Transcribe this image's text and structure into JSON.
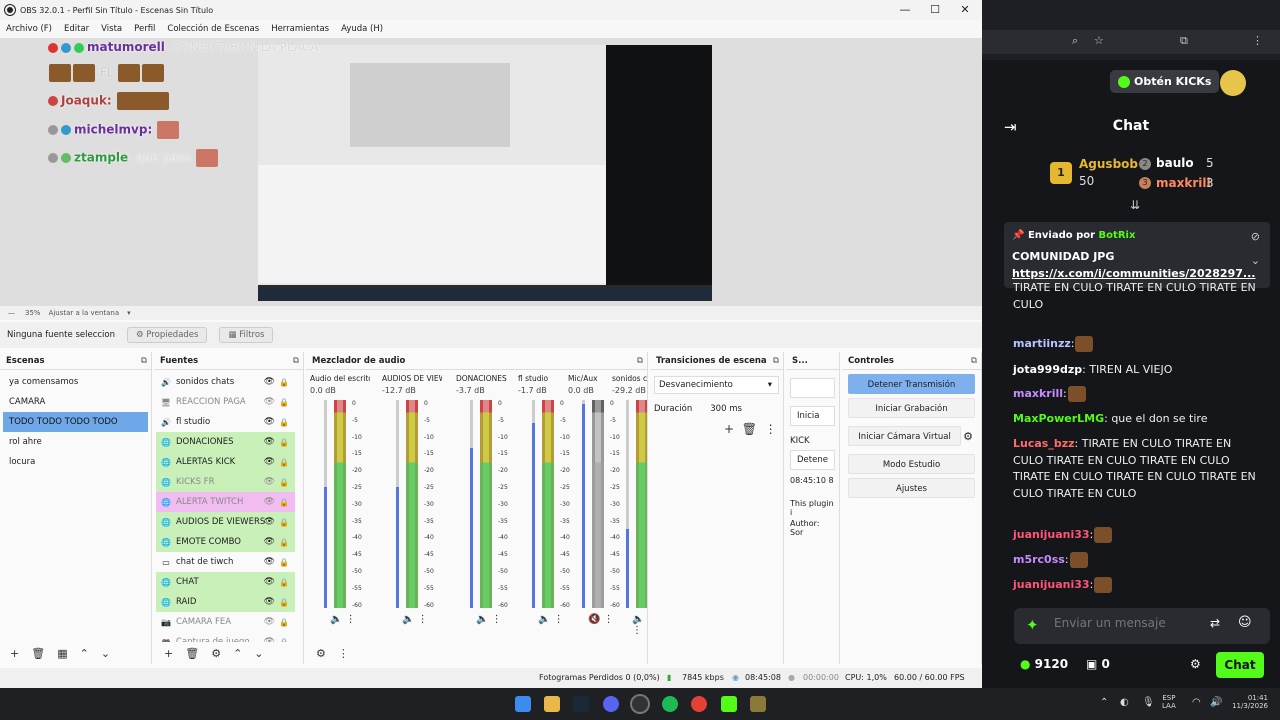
{
  "window": {
    "title": "OBS 32.0.1 - Perfil: Sin Título - Escenas: Sin Título",
    "title_visible": "OBS 32.0.1 - Perfil Sin Título - Escenas Sin Título",
    "minimize": "—",
    "maximize": "☐",
    "close": "✕"
  },
  "menu": [
    "Archivo (F)",
    "Editar",
    "Vista",
    "Perfil",
    "Colección de Escenas",
    "Herramientas",
    "Ayuda (H)"
  ],
  "overlay": [
    {
      "user": "matumorell",
      "text": ": CONECTARON LA PLACA",
      "color": "#6a2f9a"
    },
    {
      "user": "",
      "text": "FL",
      "color": "#c8c8c8"
    },
    {
      "user": "Joaquk",
      "text": ":",
      "color": "#b04040"
    },
    {
      "user": "michelmvp",
      "text": ":",
      "color": "#6a2f9a"
    },
    {
      "user": "ztample",
      "text": ": que paso",
      "color": "#2f9a40"
    }
  ],
  "zoom": {
    "value": "35%",
    "fit": "Ajustar a la ventana"
  },
  "source_toolbar": {
    "no_selection": "Ninguna fuente seleccionada",
    "properties": "Propiedades",
    "filters": "Filtros"
  },
  "scenes": {
    "title": "Escenas",
    "items": [
      "ya comensamos",
      "CAMARA",
      "TODO TODO TODO TODO",
      "rol ahre",
      "locura"
    ],
    "selected": 2
  },
  "sources": {
    "title": "Fuentes",
    "items": [
      {
        "name": "sonidos chats",
        "style": "",
        "icon": "🔊"
      },
      {
        "name": "REACCION PAGA",
        "style": "dim",
        "icon": "🖥"
      },
      {
        "name": "fl studio",
        "style": "",
        "icon": "🔊"
      },
      {
        "name": "DONACIONES",
        "style": "g",
        "icon": "🌐"
      },
      {
        "name": "ALERTAS KICK",
        "style": "g",
        "icon": "🌐"
      },
      {
        "name": "KICKS FR",
        "style": "g dim",
        "icon": "🌐"
      },
      {
        "name": "ALERTA TWITCH",
        "style": "p dim",
        "icon": "🌐"
      },
      {
        "name": "AUDIOS DE VIEWERS",
        "style": "g",
        "icon": "🌐"
      },
      {
        "name": "EMOTE COMBO",
        "style": "g",
        "icon": "🌐"
      },
      {
        "name": "chat de tiwch",
        "style": "",
        "icon": "▭"
      },
      {
        "name": "CHAT",
        "style": "g",
        "icon": "🌐"
      },
      {
        "name": "RAID",
        "style": "g",
        "icon": "🌐"
      },
      {
        "name": "CAMARA FEA",
        "style": "dim",
        "icon": "📷"
      },
      {
        "name": "Captura de juego",
        "style": "dim",
        "icon": "🎮"
      }
    ]
  },
  "mixer": {
    "title": "Mezclador de audio",
    "channels": [
      {
        "name": "Audio del escritorio",
        "db": "0.0 dB",
        "level": 0.58,
        "muted": false
      },
      {
        "name": "AUDIOS DE VIEWERS",
        "db": "-12.7 dB",
        "level": 0.58,
        "muted": false
      },
      {
        "name": "DONACIONES",
        "db": "-3.7 dB",
        "level": 0.77,
        "muted": false
      },
      {
        "name": "fl studio",
        "db": "-1.7 dB",
        "level": 0.89,
        "muted": false
      },
      {
        "name": "Mic/Aux",
        "db": "0.0 dB",
        "level": 0.98,
        "muted": true
      },
      {
        "name": "sonidos chats",
        "db": "-29.2 dB",
        "level": 0.38,
        "muted": false
      }
    ],
    "scale": [
      "0",
      "-5",
      "-10",
      "-15",
      "-20",
      "-25",
      "-30",
      "-35",
      "-40",
      "-45",
      "-50",
      "-55",
      "-60"
    ]
  },
  "transitions": {
    "title": "Transiciones de escena",
    "selected": "Desvanecimiento",
    "duration_label": "Duración",
    "duration": "300 ms"
  },
  "scene2": {
    "title": "S...",
    "btn1": "Inicia",
    "kick": "KICK",
    "btn2": "Detene",
    "time": "08:45:10  8",
    "plugin": "This plugin i",
    "author": "Author: Sor"
  },
  "controls": {
    "title": "Controles",
    "buttons": [
      "Detener Transmisión",
      "Iniciar Grabación",
      "Iniciar Cámara Virtual",
      "Modo Estudio",
      "Ajustes"
    ]
  },
  "status": {
    "dropped": "Fotogramas Perdidos 0 (0,0%)",
    "kbps": "7845 kbps",
    "stream_time": "08:45:08",
    "rec_time": "00:00:00",
    "cpu": "CPU: 1,0%",
    "fps": "60.00 / 60.00 FPS"
  },
  "kick": {
    "get_kicks": "Obtén KICKs",
    "chat_title": "Chat",
    "leaderboard": [
      {
        "name": "Agusbob",
        "value": "50",
        "rank": "1"
      },
      {
        "name": "baulo",
        "value": "5",
        "rank": "2"
      },
      {
        "name": "maxkrill",
        "value": "3",
        "rank": "3"
      }
    ],
    "pin": {
      "sent_by": "Enviado por",
      "bot": "BotRix",
      "title": "COMUNIDAD JPG",
      "link": "https://x.com/i/communities/2028297..."
    },
    "messages": [
      {
        "user": "",
        "text": "TIRATE EN CULO TIRATE EN CULO TIRATE EN CULO",
        "color": "#eee"
      },
      {
        "user": "martiinzz",
        "text": ":",
        "color": "#b7c4ff"
      },
      {
        "user": "jota999dzp",
        "text": ": TIREN AL VIEJO",
        "color": "#fff"
      },
      {
        "user": "maxkrill",
        "text": ":",
        "color": "#c48cff"
      },
      {
        "user": "MaxPowerLMG",
        "text": ": que el don se tire",
        "color": "#53fc18"
      },
      {
        "user": "Lucas_bzz",
        "text": ": TIRATE EN CULO TIRATE EN CULO TIRATE EN CULO TIRATE EN CULO TIRATE EN CULO TIRATE EN CULO TIRATE EN CULO TIRATE EN CULO",
        "color": "#ff6b6b"
      },
      {
        "user": "juanijuani33",
        "text": ":",
        "color": "#ff5577"
      },
      {
        "user": "m5rc0ss",
        "text": ":",
        "color": "#c48cff"
      },
      {
        "user": "juanijuani33",
        "text": ":",
        "color": "#ff5577"
      }
    ],
    "input_placeholder": "Enviar un mensaje",
    "points": "9120",
    "redeem": "0",
    "chat_button": "Chat"
  },
  "tray": {
    "lang": "ESP",
    "lang2": "LAA",
    "time": "01:41",
    "date": "11/3/2026"
  }
}
